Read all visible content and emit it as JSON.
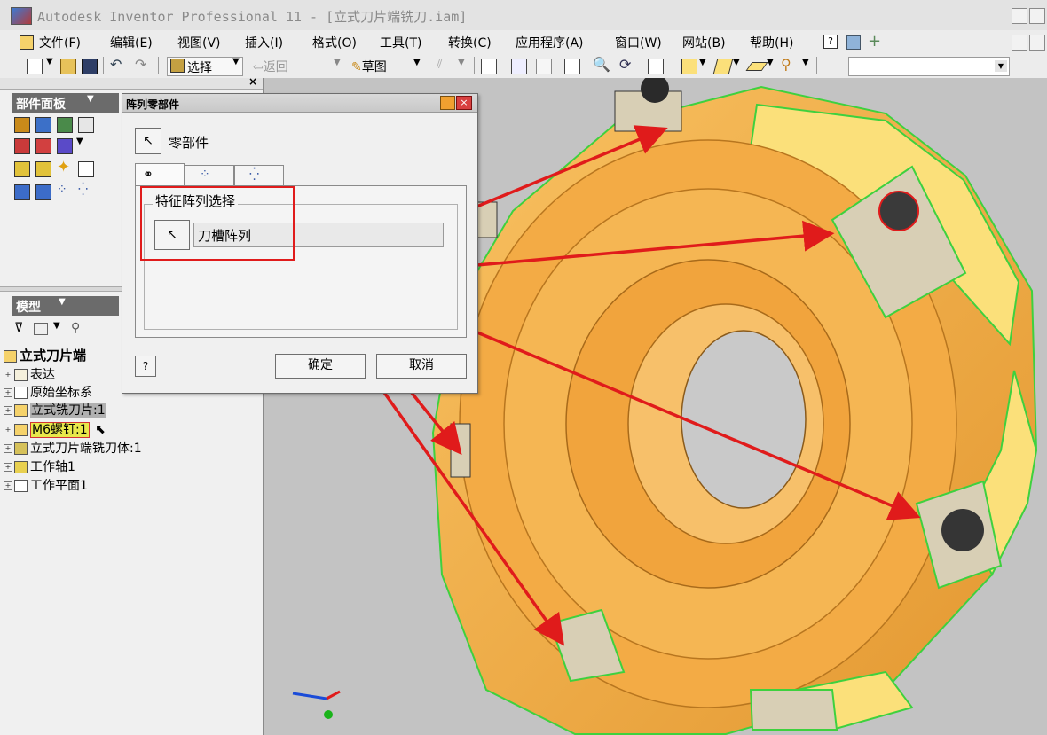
{
  "window": {
    "title": "Autodesk Inventor Professional 11 - [立式刀片端铣刀.iam]"
  },
  "menubar": {
    "items": [
      "文件(F)",
      "编辑(E)",
      "视图(V)",
      "插入(I)",
      "格式(O)",
      "工具(T)",
      "转换(C)",
      "应用程序(A)",
      "窗口(W)",
      "网站(B)",
      "帮助(H)"
    ]
  },
  "toolbar": {
    "select_label": "选择",
    "back_label": "返回",
    "sketch_label": "草图"
  },
  "parts_panel": {
    "header": "部件面板"
  },
  "model_panel": {
    "header": "模型",
    "tree": [
      {
        "label": "立式刀片端",
        "expand": ""
      },
      {
        "label": "表达",
        "expand": "+"
      },
      {
        "label": "原始坐标系",
        "expand": "+"
      },
      {
        "label": "立式铣刀片:1",
        "expand": "+"
      },
      {
        "label": "M6螺钉:1",
        "expand": "+"
      },
      {
        "label": "立式刀片端铣刀体:1",
        "expand": "+"
      },
      {
        "label": "工作轴1",
        "expand": "+"
      },
      {
        "label": "工作平面1",
        "expand": "+"
      }
    ]
  },
  "dialog": {
    "title": "阵列零部件",
    "component_label": "零部件",
    "group_label": "特征阵列选择",
    "feature_value": "刀槽阵列",
    "ok_label": "确定",
    "cancel_label": "取消"
  },
  "colors": {
    "highlight_box": "#e01b1b",
    "part_body": "#f4b14a",
    "part_face": "#fbe07a",
    "edge_highlight": "#3ed13e"
  }
}
